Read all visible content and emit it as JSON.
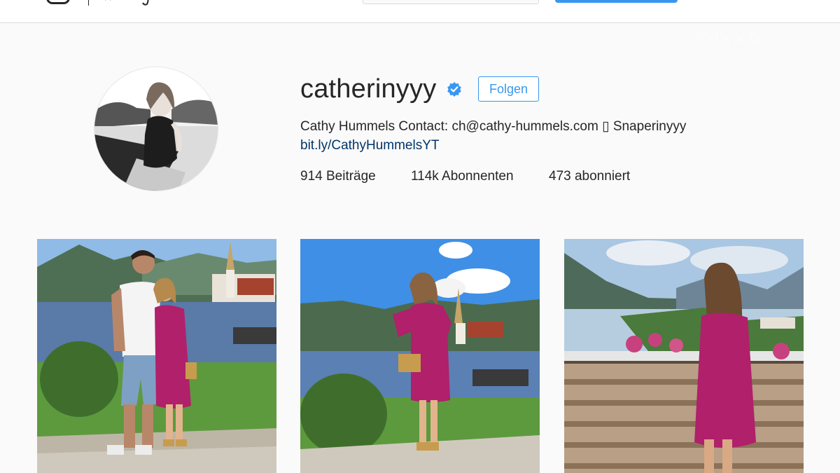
{
  "profile": {
    "username": "catherinyyy",
    "follow_label": "Folgen",
    "bio": "Cathy Hummels Contact: ch@cathy-hummels.com ▯ Snaperinyyy",
    "link": "bit.ly/CathyHummelsYT",
    "stats": {
      "posts": "914 Beiträge",
      "followers": "114k Abonnenten",
      "following": "473 abonniert"
    }
  },
  "icons": {
    "logo": "instagram-camera-icon",
    "verified": "verified-badge-icon"
  },
  "colors": {
    "accent": "#3897f0",
    "link": "#003569",
    "verified": "#3897f0",
    "dress": "#b0206b"
  },
  "posts": [
    {
      "id": "post-1",
      "description": "couple by lake"
    },
    {
      "id": "post-2",
      "description": "woman in pink dress by lake"
    },
    {
      "id": "post-3",
      "description": "woman on terrace above lake"
    }
  ]
}
